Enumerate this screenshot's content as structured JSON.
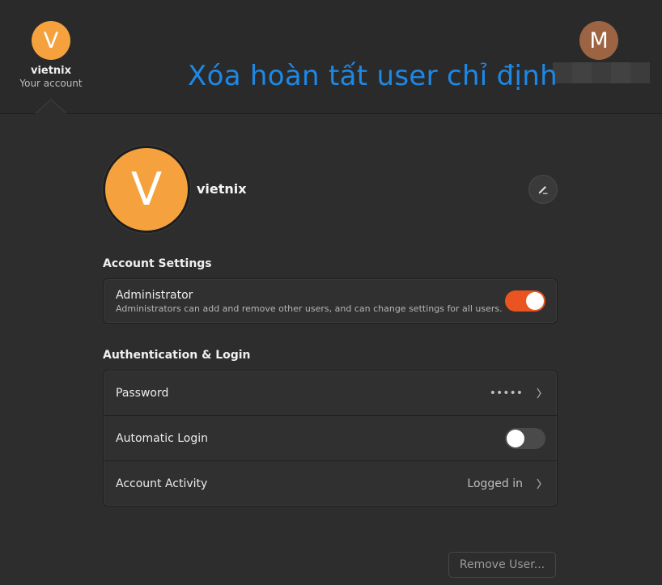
{
  "top": {
    "current_user": {
      "initial": "V",
      "name": "vietnix",
      "subtitle": "Your account",
      "color": "#f5a23e"
    },
    "other_user": {
      "initial": "M",
      "color": "#9c6443"
    },
    "banner": "Xóa hoàn tất user chỉ định"
  },
  "profile": {
    "initial": "V",
    "name": "vietnix",
    "edit_icon": "pencil-icon"
  },
  "account_settings": {
    "title": "Account Settings",
    "administrator": {
      "label": "Administrator",
      "description": "Administrators can add and remove other users, and can change settings for all users.",
      "enabled": true
    }
  },
  "auth": {
    "title": "Authentication & Login",
    "password": {
      "label": "Password",
      "value": "•••••"
    },
    "auto_login": {
      "label": "Automatic Login",
      "enabled": false
    },
    "activity": {
      "label": "Account Activity",
      "value": "Logged in"
    }
  },
  "remove_button": "Remove User...",
  "colors": {
    "accent": "#e95420",
    "banner_blue": "#1e88e5"
  }
}
